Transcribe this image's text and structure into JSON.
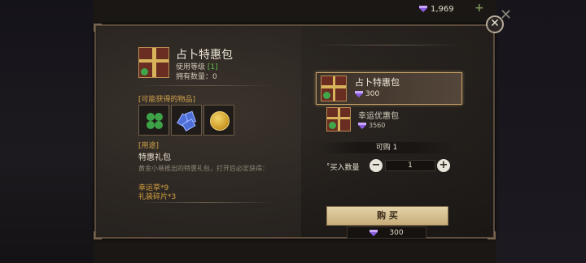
{
  "currency": {
    "amount": "1,969",
    "icon": "gem-icon"
  },
  "close_label": "✕",
  "item": {
    "title": "占卜特惠包",
    "level_prefix": "使用等级 ",
    "level_value": "[1]",
    "owned": "拥有数量：0"
  },
  "obtainable": {
    "label": "[可能获得的物品]",
    "items": [
      "four-leaf-clover",
      "jewel-shards",
      "gold-coin"
    ]
  },
  "usage": {
    "label": "[用途]",
    "type": "特惠礼包",
    "description": "黄金小巷推出的特惠礼包，打开后必定获得：",
    "rewards": [
      "幸运草*9",
      "礼装碎片*3"
    ]
  },
  "shop_list": [
    {
      "name": "占卜特惠包",
      "price": "300",
      "selected": true
    },
    {
      "name": "幸运优惠包",
      "price": "3560",
      "selected": false
    }
  ],
  "purchase": {
    "can_buy": "可购 1",
    "qty_label": "˚买入数量",
    "quantity": "1",
    "minus": "−",
    "plus": "+",
    "buy_label": "购 买",
    "price": "300"
  },
  "colors": {
    "accent_gold": "#d0a24a",
    "level_green": "#5fbf4f",
    "panel_border": "#5b4c3e"
  }
}
